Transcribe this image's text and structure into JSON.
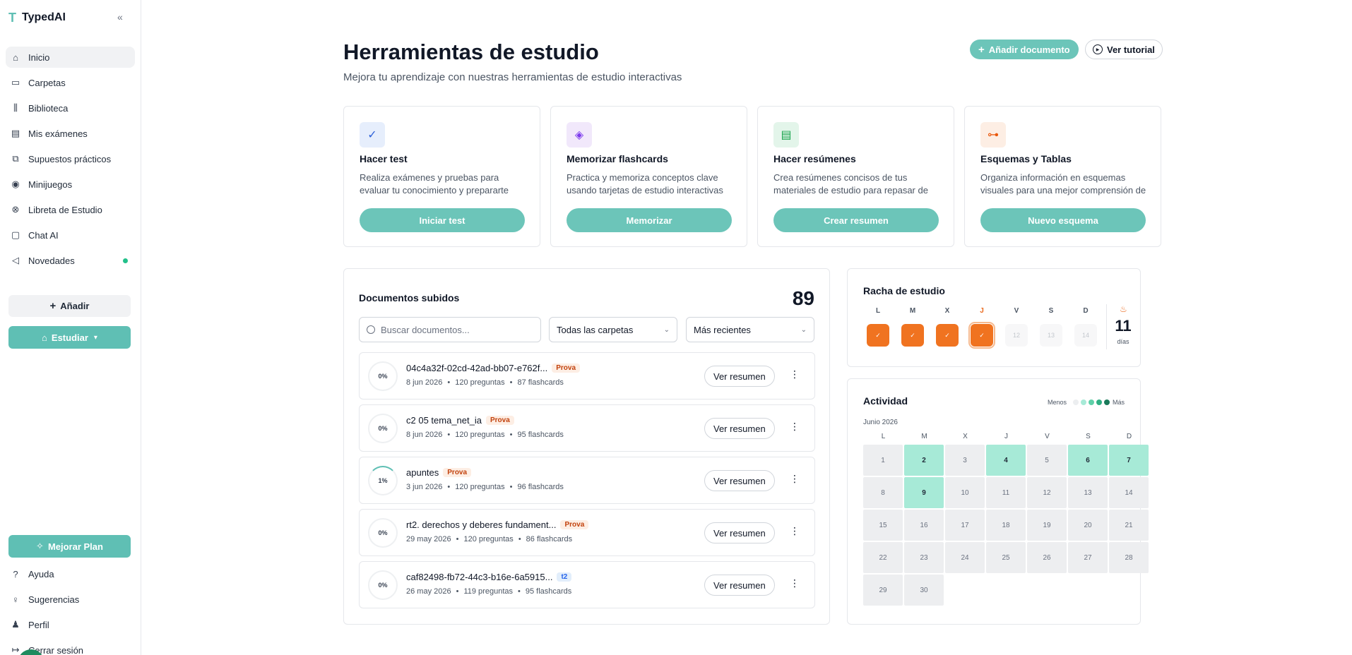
{
  "brand": {
    "logo": "T",
    "name": "TypedAI",
    "collapse": "«"
  },
  "sidebar": {
    "items": [
      {
        "label": "Inicio",
        "icon": "home-icon",
        "glyph": "⌂"
      },
      {
        "label": "Carpetas",
        "icon": "folder-icon",
        "glyph": "▭"
      },
      {
        "label": "Biblioteca",
        "icon": "library-icon",
        "glyph": "⫼"
      },
      {
        "label": "Mis exámenes",
        "icon": "file-icon",
        "glyph": "▤"
      },
      {
        "label": "Supuestos prácticos",
        "icon": "book-icon",
        "glyph": "⧉"
      },
      {
        "label": "Minijuegos",
        "icon": "gamepad-icon",
        "glyph": "◉"
      },
      {
        "label": "Libreta de Estudio",
        "icon": "notebook-icon",
        "glyph": "⊗"
      },
      {
        "label": "Chat AI",
        "icon": "chat-icon",
        "glyph": "▢"
      },
      {
        "label": "Novedades",
        "icon": "megaphone-icon",
        "glyph": "◁"
      }
    ],
    "add_label": "Añadir",
    "study_label": "Estudiar",
    "plan_label": "Mejorar Plan",
    "bottom": [
      {
        "label": "Ayuda",
        "icon": "help-icon",
        "glyph": "?"
      },
      {
        "label": "Sugerencias",
        "icon": "lightbulb-icon",
        "glyph": "♀"
      },
      {
        "label": "Perfil",
        "icon": "user-icon",
        "glyph": "♟"
      },
      {
        "label": "Cerrar sesión",
        "icon": "logout-icon",
        "glyph": "↦"
      }
    ]
  },
  "header": {
    "title": "Herramientas de estudio",
    "subtitle": "Mejora tu aprendizaje con nuestras herramientas de estudio interactivas",
    "add_doc_label": "Añadir documento",
    "tutorial_label": "Ver tutorial"
  },
  "tools": [
    {
      "title": "Hacer test",
      "desc": "Realiza exámenes y pruebas para evaluar tu conocimiento y prepararte para tus exámenes",
      "button": "Iniciar test",
      "icon": "clipboard-check-icon",
      "glyph": "✓",
      "icon_bg": "#e6eefc",
      "icon_color": "#2f62d9"
    },
    {
      "title": "Memorizar flashcards",
      "desc": "Practica y memoriza conceptos clave usando tarjetas de estudio interactivas",
      "button": "Memorizar",
      "icon": "layers-icon",
      "glyph": "◈",
      "icon_bg": "#f1e8fb",
      "icon_color": "#7c3aed"
    },
    {
      "title": "Hacer resúmenes",
      "desc": "Crea resúmenes concisos de tus materiales de estudio para repasar de forma rápida",
      "button": "Crear resumen",
      "icon": "scroll-icon",
      "glyph": "▤",
      "icon_bg": "#e3f5ea",
      "icon_color": "#16a34a"
    },
    {
      "title": "Esquemas y Tablas",
      "desc": "Organiza información en esquemas visuales para una mejor comprensión de los temas",
      "button": "Nuevo esquema",
      "icon": "network-icon",
      "glyph": "⊶",
      "icon_bg": "#fdeee4",
      "icon_color": "#ea580c"
    }
  ],
  "documents": {
    "title": "Documentos subidos",
    "count": "89",
    "search_placeholder": "Buscar documentos...",
    "folder_filter": "Todas las carpetas",
    "sort": "Más recientes",
    "summary_label": "Ver resumen",
    "rows": [
      {
        "pct": "0%",
        "progress": 0,
        "name": "04c4a32f-02cd-42ad-bb07-e762f...",
        "tag": "Prova",
        "tag_type": "prova",
        "date": "8 jun 2026",
        "questions": "120 preguntas",
        "flashcards": "87 flashcards"
      },
      {
        "pct": "0%",
        "progress": 0,
        "name": "c2 05 tema_net_ia",
        "tag": "Prova",
        "tag_type": "prova",
        "date": "8 jun 2026",
        "questions": "120 preguntas",
        "flashcards": "95 flashcards"
      },
      {
        "pct": "1%",
        "progress": 1,
        "name": "apuntes",
        "tag": "Prova",
        "tag_type": "prova",
        "date": "3 jun 2026",
        "questions": "120 preguntas",
        "flashcards": "96 flashcards"
      },
      {
        "pct": "0%",
        "progress": 0,
        "name": "rt2. derechos y deberes fundament...",
        "tag": "Prova",
        "tag_type": "prova",
        "date": "29 may 2026",
        "questions": "120 preguntas",
        "flashcards": "86 flashcards"
      },
      {
        "pct": "0%",
        "progress": 0,
        "name": "caf82498-fb72-44c3-b16e-6a5915...",
        "tag": "t2",
        "tag_type": "t2",
        "date": "26 may 2026",
        "questions": "119 preguntas",
        "flashcards": "95 flashcards"
      }
    ]
  },
  "streak": {
    "title": "Racha de estudio",
    "days": [
      {
        "label": "L",
        "state": "done",
        "num": ""
      },
      {
        "label": "M",
        "state": "done",
        "num": ""
      },
      {
        "label": "X",
        "state": "done",
        "num": ""
      },
      {
        "label": "J",
        "state": "today",
        "num": ""
      },
      {
        "label": "V",
        "state": "future",
        "num": "12"
      },
      {
        "label": "S",
        "state": "future",
        "num": "13"
      },
      {
        "label": "D",
        "state": "future",
        "num": "14"
      }
    ],
    "count": "11",
    "unit": "días"
  },
  "activity": {
    "title": "Actividad",
    "legend_less": "Menos",
    "legend_more": "Más",
    "legend_colors": [
      "#eceef0",
      "#a7ead7",
      "#5fd0a8",
      "#2fae82",
      "#1a7a5a"
    ],
    "month": "Junio 2026",
    "weekdays": [
      "L",
      "M",
      "X",
      "J",
      "V",
      "S",
      "D"
    ],
    "days": [
      "1",
      "2",
      "3",
      "4",
      "5",
      "6",
      "7",
      "8",
      "9",
      "10",
      "11",
      "12",
      "13",
      "14",
      "15",
      "16",
      "17",
      "18",
      "19",
      "20",
      "21",
      "22",
      "23",
      "24",
      "25",
      "26",
      "27",
      "28",
      "29",
      "30"
    ],
    "active_days": [
      "2",
      "4",
      "6",
      "7",
      "9"
    ]
  }
}
